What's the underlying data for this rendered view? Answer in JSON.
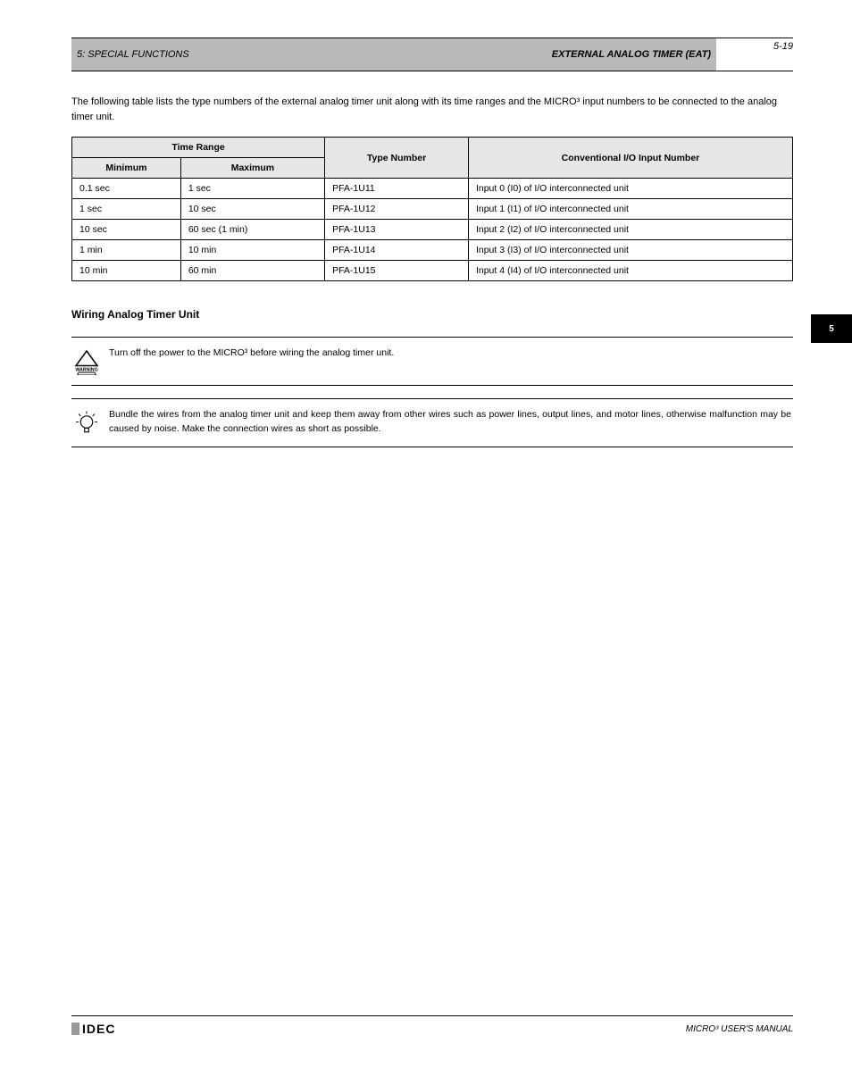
{
  "header": {
    "chapter": "5: SPECIAL FUNCTIONS",
    "section": "EXTERNAL ANALOG TIMER (EAT)"
  },
  "side_tab": "5",
  "page_number": "5-19",
  "intro": "The following table lists the type numbers of the external analog timer unit along with its time ranges and the MICRO³ input numbers to be connected to the analog timer unit.",
  "table": {
    "header_range": "Time Range",
    "header_type": "Type Number",
    "header_input": "Conventional I/O Input Number",
    "header_min": "Minimum",
    "header_max": "Maximum",
    "rows": [
      {
        "min": "0.1 sec",
        "max": "1 sec",
        "type": "PFA-1U11",
        "input": "Input 0 (I0) of I/O interconnected unit"
      },
      {
        "min": "1 sec",
        "max": "10 sec",
        "type": "PFA-1U12",
        "input": "Input 1 (I1) of I/O interconnected unit"
      },
      {
        "min": "10 sec",
        "max": "60 sec (1 min)",
        "type": "PFA-1U13",
        "input": "Input 2 (I2) of I/O interconnected unit"
      },
      {
        "min": "1 min",
        "max": "10 min",
        "type": "PFA-1U14",
        "input": "Input 3 (I3) of I/O interconnected unit"
      },
      {
        "min": "10 min",
        "max": "60 min",
        "type": "PFA-1U15",
        "input": "Input 4 (I4) of I/O interconnected unit"
      }
    ]
  },
  "subheading": "Wiring Analog Timer Unit",
  "warning_text": "Turn off the power to the MICRO³ before wiring the analog timer unit.",
  "tip_text": "Bundle the wires from the analog timer unit and keep them away from other wires such as power lines, output lines, and motor lines, otherwise malfunction may be caused by noise. Make the connection wires as short as possible.",
  "footer": {
    "logo_text": "IDEC",
    "manual": "MICRO³ USER'S MANUAL"
  }
}
